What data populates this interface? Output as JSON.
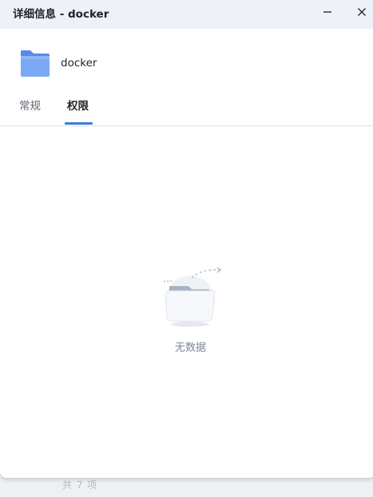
{
  "window": {
    "title": "详细信息 - docker",
    "minimize_icon": "minimize-icon",
    "close_icon": "close-icon"
  },
  "item": {
    "icon": "folder-icon",
    "name": "docker"
  },
  "tabs": [
    {
      "label": "常规",
      "active": false
    },
    {
      "label": "权限",
      "active": true
    }
  ],
  "empty_state": {
    "icon": "empty-folder-icon",
    "text": "无数据"
  },
  "background": {
    "footer_text": "共 7 项"
  },
  "colors": {
    "accent": "#3d7bdc",
    "folder": "#6f9eef"
  }
}
